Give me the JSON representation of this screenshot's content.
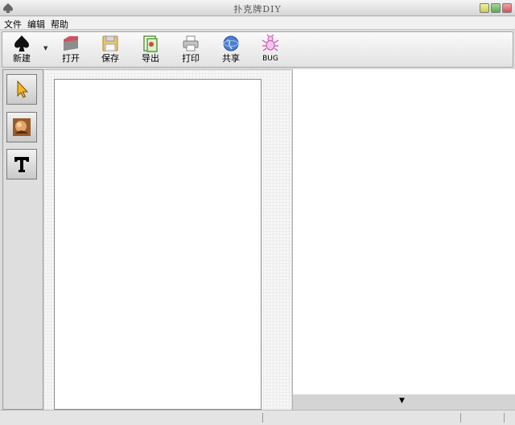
{
  "window": {
    "title": "扑克牌DIY"
  },
  "menu": [
    "文件",
    "编辑",
    "帮助"
  ],
  "toolbar": [
    {
      "id": "new",
      "label": "新建",
      "icon": "spade-icon",
      "has_dropdown": true
    },
    {
      "id": "open",
      "label": "打开",
      "icon": "folder-open-icon"
    },
    {
      "id": "save",
      "label": "保存",
      "icon": "floppy-save-icon"
    },
    {
      "id": "export",
      "label": "导出",
      "icon": "cards-export-icon"
    },
    {
      "id": "print",
      "label": "打印",
      "icon": "printer-icon"
    },
    {
      "id": "share",
      "label": "共享",
      "icon": "globe-share-icon"
    },
    {
      "id": "bug",
      "label": "BUG",
      "icon": "bug-icon"
    }
  ],
  "side_tools": [
    {
      "id": "select",
      "icon": "pointer-arrow-icon"
    },
    {
      "id": "image",
      "icon": "image-icon"
    },
    {
      "id": "text",
      "icon": "text-t-icon",
      "glyph": "T"
    }
  ],
  "right_panel": {
    "collapse_icon": "triangle-down-icon"
  },
  "colors": {
    "close": "#d45454",
    "maximize": "#5fa94a",
    "minimize": "#c8cc55",
    "canvas_grid": "#ececec"
  }
}
